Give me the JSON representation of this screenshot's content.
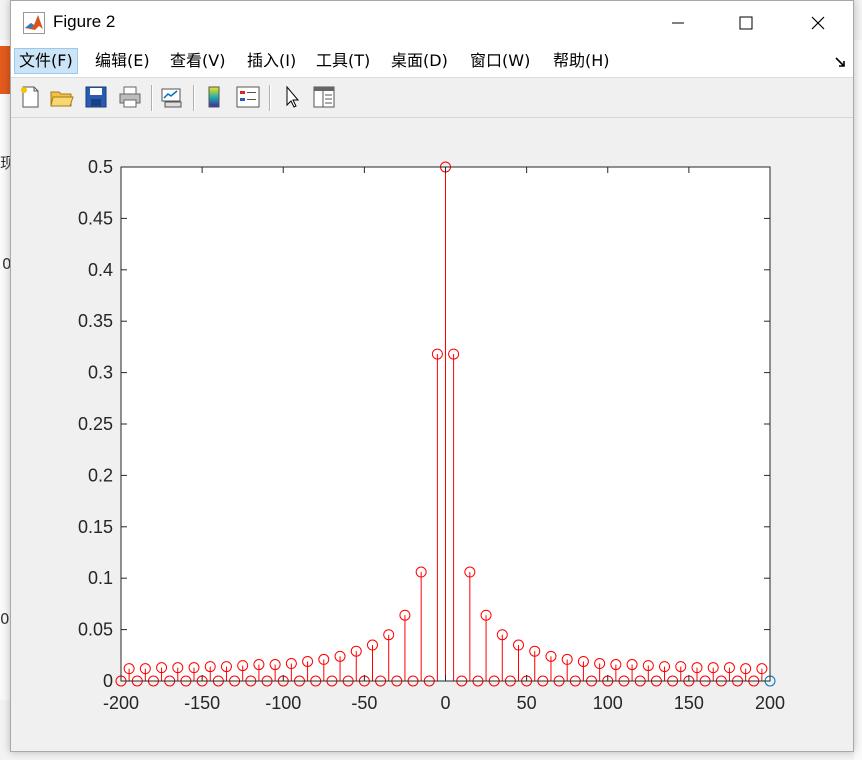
{
  "window": {
    "title": "Figure 2",
    "controls": [
      "minimize",
      "maximize",
      "close"
    ]
  },
  "menu": {
    "items": [
      {
        "label": "文件(F)"
      },
      {
        "label": "编辑(E)"
      },
      {
        "label": "查看(V)"
      },
      {
        "label": "插入(I)"
      },
      {
        "label": "工具(T)"
      },
      {
        "label": "桌面(D)"
      },
      {
        "label": "窗口(W)"
      },
      {
        "label": "帮助(H)"
      }
    ]
  },
  "toolbar": {
    "icons": [
      "new-figure-icon",
      "open-file-icon",
      "save-figure-icon",
      "print-figure-icon",
      "link-plot-icon",
      "insert-colorbar-icon",
      "insert-legend-icon",
      "edit-plot-icon",
      "property-inspector-icon"
    ]
  },
  "background": {
    "glyph_1": "现",
    "glyph_2": "0",
    "glyph_3": "0"
  },
  "colors": {
    "series_red": "#ff0000",
    "series_blue": "#0072bd",
    "axes_bg": "#ffffff",
    "figure_bg": "#f0f0f0"
  },
  "chart_data": {
    "type": "stem",
    "title": "",
    "xlabel": "",
    "ylabel": "",
    "xlim": [
      -200,
      200
    ],
    "ylim": [
      0,
      0.5
    ],
    "xticks": [
      -200,
      -150,
      -100,
      -50,
      0,
      50,
      100,
      150,
      200
    ],
    "yticks": [
      0,
      0.05,
      0.1,
      0.15,
      0.2,
      0.25,
      0.3,
      0.35,
      0.4,
      0.45,
      0.5
    ],
    "xtick_labels": [
      "-200",
      "-150",
      "-100",
      "-50",
      "0",
      "50",
      "100",
      "150",
      "200"
    ],
    "ytick_labels": [
      "0",
      "0.05",
      "0.1",
      "0.15",
      "0.2",
      "0.25",
      "0.3",
      "0.35",
      "0.4",
      "0.45",
      "0.5"
    ],
    "grid": false,
    "marker": "circle",
    "series": [
      {
        "color": "red",
        "x": [
          -200,
          -195,
          -190,
          -185,
          -180,
          -175,
          -170,
          -165,
          -160,
          -155,
          -150,
          -145,
          -140,
          -135,
          -130,
          -125,
          -120,
          -115,
          -110,
          -105,
          -100,
          -95,
          -90,
          -85,
          -80,
          -75,
          -70,
          -65,
          -60,
          -55,
          -50,
          -45,
          -40,
          -35,
          -30,
          -25,
          -20,
          -15,
          -10,
          -5,
          0,
          5,
          10,
          15,
          20,
          25,
          30,
          35,
          40,
          45,
          50,
          55,
          60,
          65,
          70,
          75,
          80,
          85,
          90,
          95,
          100,
          105,
          110,
          115,
          120,
          125,
          130,
          135,
          140,
          145,
          150,
          155,
          160,
          165,
          170,
          175,
          180,
          185,
          190,
          195
        ],
        "y": [
          0,
          0.012,
          0,
          0.012,
          0,
          0.013,
          0,
          0.013,
          0,
          0.013,
          0,
          0.014,
          0,
          0.014,
          0,
          0.015,
          0,
          0.016,
          0,
          0.016,
          0,
          0.017,
          0,
          0.019,
          0,
          0.021,
          0,
          0.024,
          0,
          0.029,
          0,
          0.035,
          0,
          0.045,
          0,
          0.064,
          0,
          0.106,
          0,
          0.318,
          0.5,
          0.318,
          0,
          0.106,
          0,
          0.064,
          0,
          0.045,
          0,
          0.035,
          0,
          0.029,
          0,
          0.024,
          0,
          0.021,
          0,
          0.019,
          0,
          0.017,
          0,
          0.016,
          0,
          0.016,
          0,
          0.015,
          0,
          0.014,
          0,
          0.014,
          0,
          0.013,
          0,
          0.013,
          0,
          0.013,
          0,
          0.012,
          0,
          0.012
        ]
      },
      {
        "color": "blue",
        "x": [
          200
        ],
        "y": [
          0
        ]
      }
    ]
  }
}
